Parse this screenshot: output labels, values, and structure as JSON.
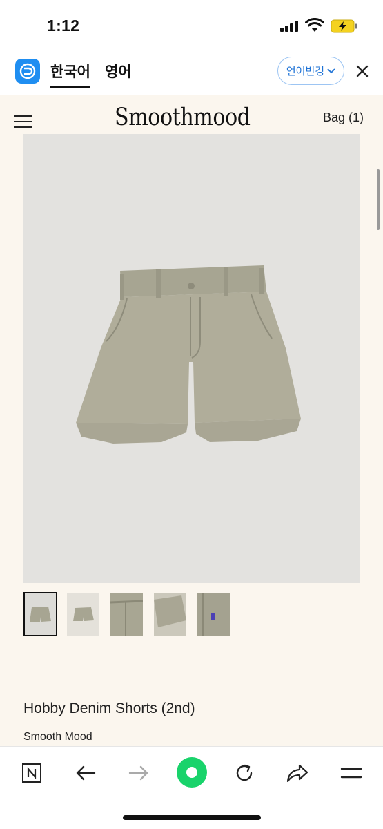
{
  "status": {
    "time": "1:12"
  },
  "translator": {
    "tab_korean": "한국어",
    "tab_english": "영어",
    "change_language": "언어변경",
    "accent_color": "#1f8ef1"
  },
  "site": {
    "logo": "Smoothmood",
    "bag": "Bag (1)"
  },
  "product": {
    "title": "Hobby Denim Shorts (2nd)",
    "brand": "Smooth Mood",
    "thumbnail_count": 5,
    "active_thumbnail": 1
  },
  "toolbar": {
    "icons": [
      "naver-n-icon",
      "back-arrow-icon",
      "forward-arrow-icon",
      "green-dot-icon",
      "refresh-icon",
      "share-icon",
      "menu-icon"
    ]
  }
}
